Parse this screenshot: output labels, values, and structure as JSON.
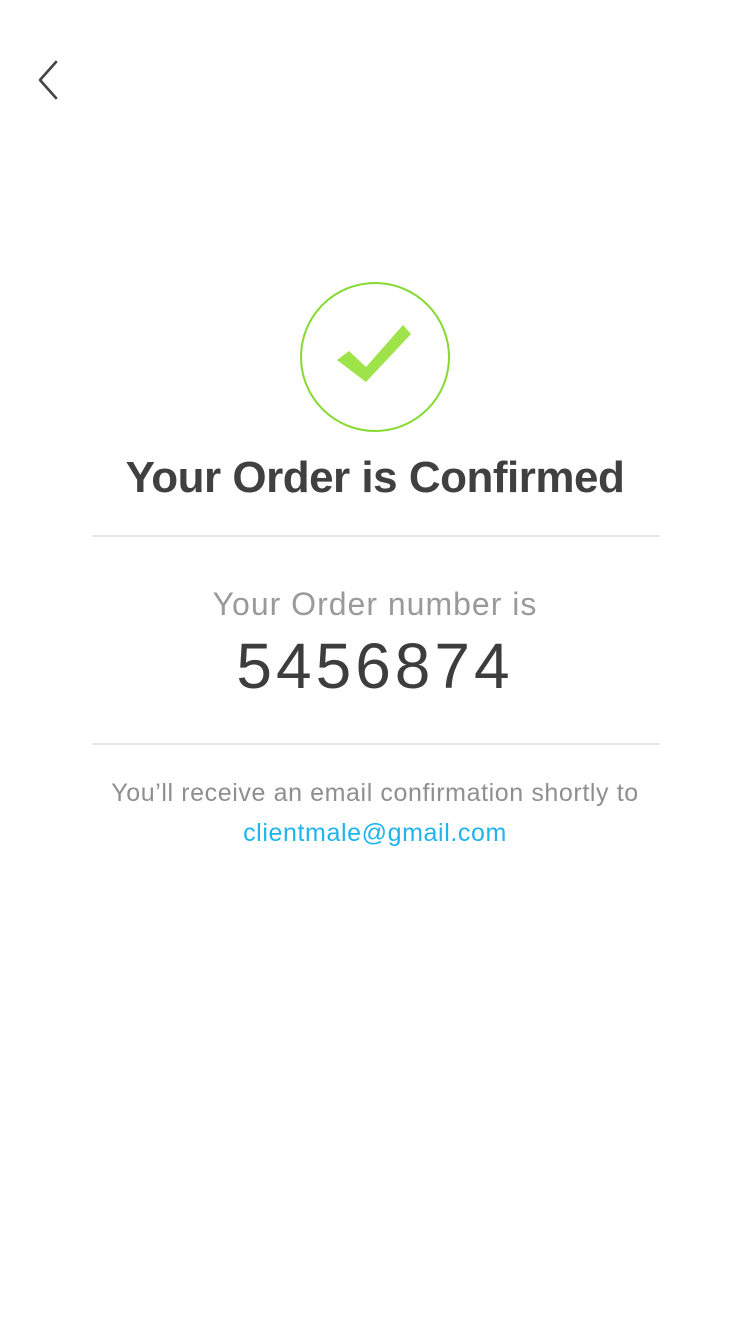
{
  "nav": {
    "back_icon": "chevron-left-icon"
  },
  "status": {
    "icon": "checkmark-icon",
    "accent_color": "#86d92f",
    "check_color": "#9ee34a"
  },
  "confirmation": {
    "title": "Your Order is Confirmed",
    "order_label": "Your Order number is",
    "order_number": "5456874",
    "email_note": "You’ll receive an email confirmation shortly to",
    "email": "clientmale@gmail.com",
    "link_color": "#1eb5ee"
  }
}
